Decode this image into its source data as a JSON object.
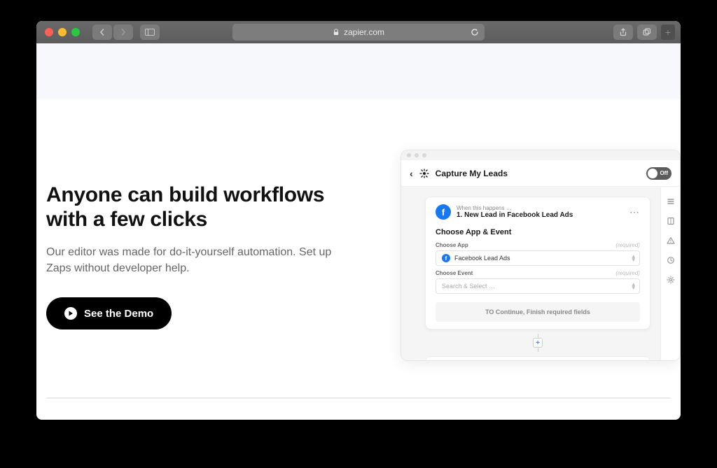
{
  "browser": {
    "url_host": "zapier.com"
  },
  "hero": {
    "headline": "Anyone can build workflows with a few clicks",
    "subhead": "Our editor was made for do-it-yourself automation. Set up Zaps without developer help.",
    "cta_label": "See the Demo"
  },
  "editor": {
    "zap_name": "Capture My Leads",
    "toggle_label": "Off",
    "trigger": {
      "when_label": "When this happens …",
      "title": "1. New Lead in Facebook Lead Ads",
      "section_title": "Choose App & Event",
      "app_label": "Choose App",
      "app_value": "Facebook Lead Ads",
      "event_label": "Choose Event",
      "event_placeholder": "Search & Select …",
      "required_hint": "(required)",
      "continue_label": "TO Continue, Finish required fields"
    }
  }
}
